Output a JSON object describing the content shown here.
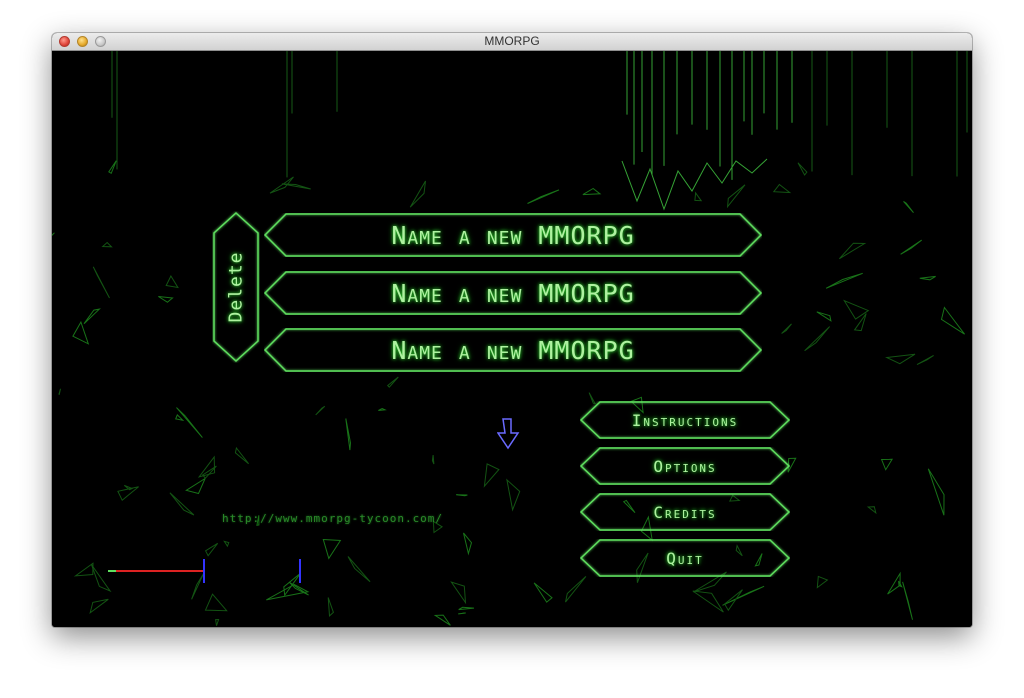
{
  "window": {
    "title": "MMORPG"
  },
  "save_slots": [
    {
      "label": "Name a new MMORPG"
    },
    {
      "label": "Name a new MMORPG"
    },
    {
      "label": "Name a new MMORPG"
    }
  ],
  "delete_button": {
    "label": "Delete"
  },
  "menu": [
    {
      "id": "instructions",
      "label": "Instructions"
    },
    {
      "id": "options",
      "label": "Options"
    },
    {
      "id": "credits",
      "label": "Credits"
    },
    {
      "id": "quit",
      "label": "Quit"
    }
  ],
  "website": "http://www.mmorpg-tycoon.com/",
  "cursor": {
    "icon": "arrow-down-cursor-icon",
    "color": "#6a6aff"
  },
  "colors": {
    "neon_green": "#5fdf5f",
    "text_green": "#aef2a0",
    "background": "#000000",
    "bar_red": "#dd2222",
    "bar_blue": "#3333ff"
  }
}
